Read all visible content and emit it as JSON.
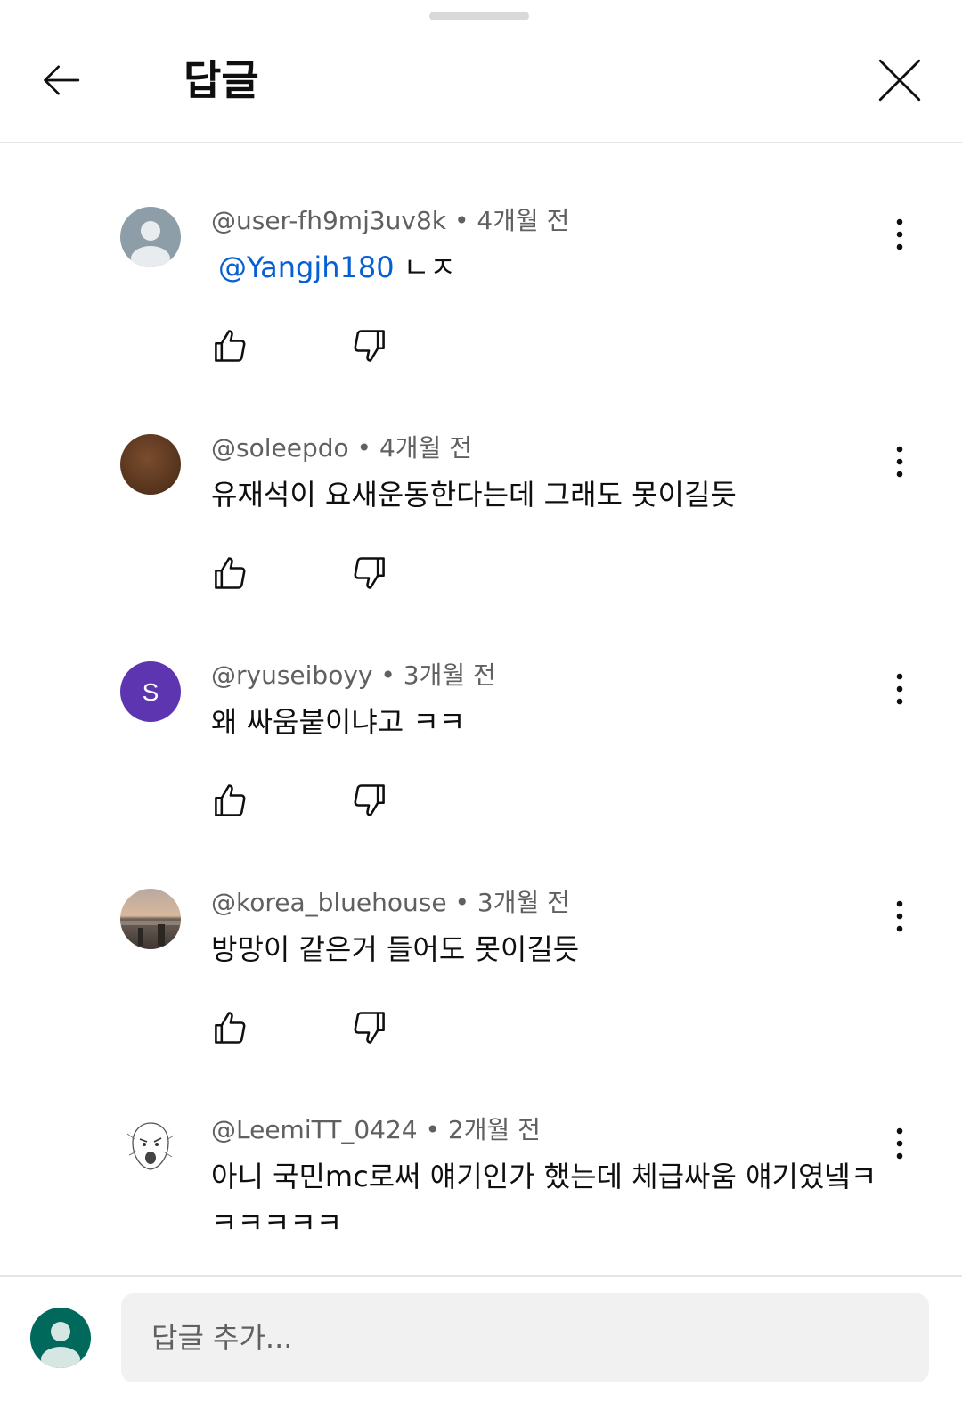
{
  "header": {
    "title": "답글"
  },
  "comments": [
    {
      "author": "@user-fh9mj3uv8k",
      "time": "4개월 전",
      "mention": "@Yangjh180",
      "text": "ㄴㅈ",
      "avatar": "default-gray"
    },
    {
      "author": "@soleepdo",
      "time": "4개월 전",
      "text": "유재석이 요새운동한다는데 그래도 못이길듯",
      "avatar": "brown-photo"
    },
    {
      "author": "@ryuseiboyy",
      "time": "3개월 전",
      "text": "왜 싸움붙이냐고 ㅋㅋ",
      "avatar": "letter",
      "avatar_letter": "S"
    },
    {
      "author": "@korea_bluehouse",
      "time": "3개월 전",
      "text": "방망이 같은거 들어도 못이길듯",
      "avatar": "sunset-photo"
    },
    {
      "author": "@LeemiTT_0424",
      "time": "2개월 전",
      "text": "아니 국민mc로써 얘기인가 했는데 체급싸움 얘기였넼ㅋㅋㅋㅋㅋㅋ",
      "avatar": "sketch-face"
    }
  ],
  "separator": "•",
  "reply_box": {
    "placeholder": "답글 추가..."
  },
  "icons": {
    "back": "arrow-left-icon",
    "close": "close-icon",
    "more": "more-vert-icon",
    "like": "thumb-up-icon",
    "dislike": "thumb-down-icon"
  },
  "colors": {
    "mention": "#065fd4",
    "meta": "#606060",
    "text": "#0f0f0f",
    "avatar_purple": "#5e35b1",
    "my_avatar": "#00695c"
  }
}
